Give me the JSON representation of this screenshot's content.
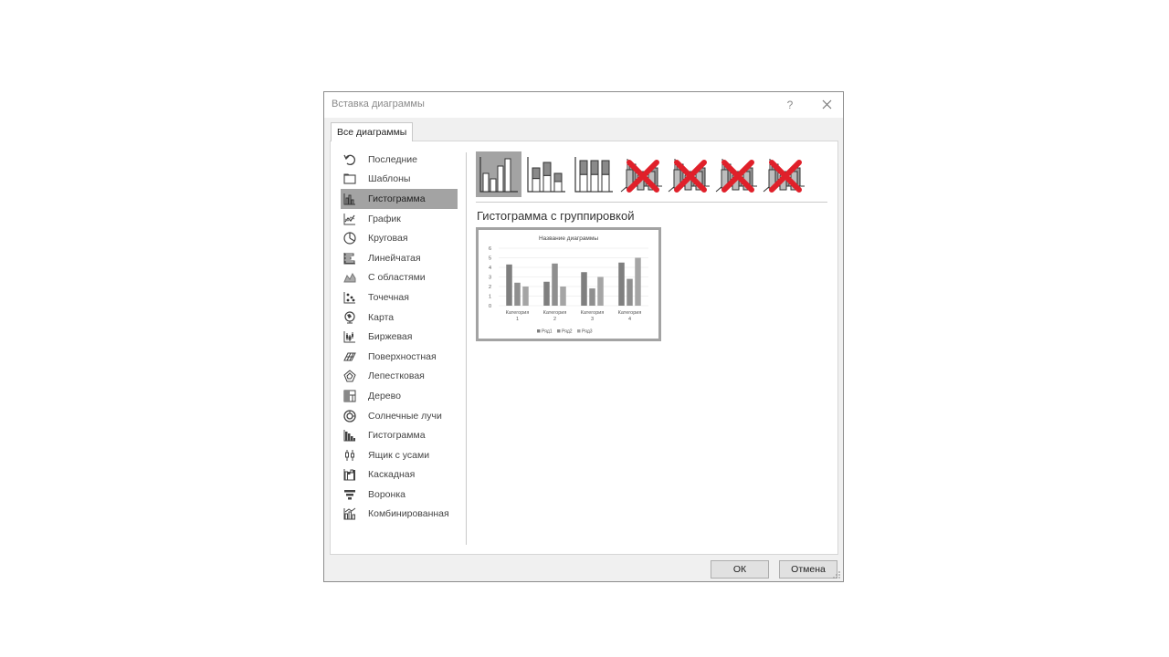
{
  "dialog": {
    "title": "Вставка диаграммы",
    "help_label": "?",
    "tab_label": "Все диаграммы",
    "ok_label": "ОК",
    "cancel_label": "Отмена"
  },
  "chart_types": [
    {
      "label": "Последние",
      "icon": "recent-icon"
    },
    {
      "label": "Шаблоны",
      "icon": "folder-icon"
    },
    {
      "label": "Гистограмма",
      "icon": "column-chart-icon",
      "selected": true
    },
    {
      "label": "График",
      "icon": "line-chart-icon"
    },
    {
      "label": "Круговая",
      "icon": "pie-chart-icon"
    },
    {
      "label": "Линейчатая",
      "icon": "bar-chart-icon"
    },
    {
      "label": "С областями",
      "icon": "area-chart-icon"
    },
    {
      "label": "Точечная",
      "icon": "scatter-chart-icon"
    },
    {
      "label": "Карта",
      "icon": "map-chart-icon"
    },
    {
      "label": "Биржевая",
      "icon": "stock-chart-icon"
    },
    {
      "label": "Поверхностная",
      "icon": "surface-chart-icon"
    },
    {
      "label": "Лепестковая",
      "icon": "radar-chart-icon"
    },
    {
      "label": "Дерево",
      "icon": "treemap-chart-icon"
    },
    {
      "label": "Солнечные лучи",
      "icon": "sunburst-chart-icon"
    },
    {
      "label": "Гистограмма",
      "icon": "histogram-chart-icon"
    },
    {
      "label": "Ящик с усами",
      "icon": "box-whisker-chart-icon"
    },
    {
      "label": "Каскадная",
      "icon": "waterfall-chart-icon"
    },
    {
      "label": "Воронка",
      "icon": "funnel-chart-icon"
    },
    {
      "label": "Комбинированная",
      "icon": "combo-chart-icon"
    }
  ],
  "selected_subtype_label": "Гистограмма с группировкой",
  "subtypes": [
    {
      "icon": "clustered-column-icon",
      "selected": true,
      "crossed": false
    },
    {
      "icon": "stacked-column-icon",
      "selected": false,
      "crossed": false
    },
    {
      "icon": "100-stacked-column-icon",
      "selected": false,
      "crossed": false
    },
    {
      "icon": "3d-clustered-column-icon",
      "selected": false,
      "crossed": true
    },
    {
      "icon": "3d-stacked-column-icon",
      "selected": false,
      "crossed": true
    },
    {
      "icon": "3d-100-stacked-column-icon",
      "selected": false,
      "crossed": true
    },
    {
      "icon": "3d-column-icon",
      "selected": false,
      "crossed": true
    }
  ],
  "colors": {
    "selection": "#a3a3a3",
    "cross": "#e0202a",
    "series": [
      "#7f7f7f",
      "#8f8f8f",
      "#a5a5a5"
    ]
  },
  "chart_data": {
    "type": "bar",
    "title": "Название диаграммы",
    "categories": [
      "Категория 1",
      "Категория 2",
      "Категория 3",
      "Категория 4"
    ],
    "series": [
      {
        "name": "Ряд1",
        "values": [
          4.3,
          2.5,
          3.5,
          4.5
        ]
      },
      {
        "name": "Ряд2",
        "values": [
          2.4,
          4.4,
          1.8,
          2.8
        ]
      },
      {
        "name": "Ряд3",
        "values": [
          2,
          2,
          3,
          5
        ]
      }
    ],
    "ylim": [
      0,
      6
    ],
    "yticks": [
      "6",
      "5",
      "4",
      "3",
      "2",
      "1",
      "0"
    ],
    "grid": true,
    "legend": "bottom"
  }
}
